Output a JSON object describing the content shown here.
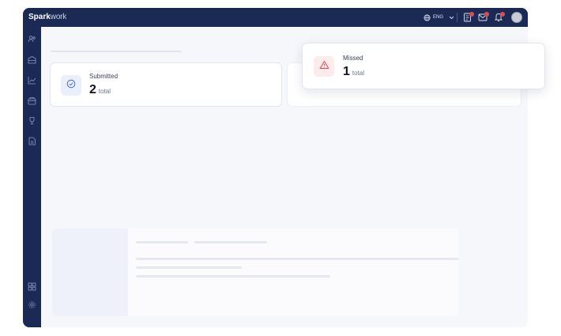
{
  "app": {
    "brand_strong": "Spark",
    "brand_light": "work",
    "language": "ENG"
  },
  "cards": {
    "submitted": {
      "title": "Submitted",
      "value": "2",
      "unit": "total",
      "icon": "check-circle-icon"
    },
    "missed": {
      "title": "Missed",
      "value": "1",
      "unit": "total",
      "icon": "warning-triangle-icon"
    }
  },
  "topbar_icons": [
    "globe-icon",
    "chevron-down-icon",
    "clipboard-icon",
    "mail-icon",
    "bell-icon",
    "avatar"
  ],
  "sidebar_icons": [
    "users-icon",
    "building-icon",
    "chart-icon",
    "wallet-icon",
    "trophy-icon",
    "document-icon",
    "grid-icon",
    "gear-icon"
  ],
  "colors": {
    "nav": "#1b2a55",
    "accent": "#4a6fd8",
    "danger": "#e5484d",
    "background": "#f6f7fb"
  }
}
